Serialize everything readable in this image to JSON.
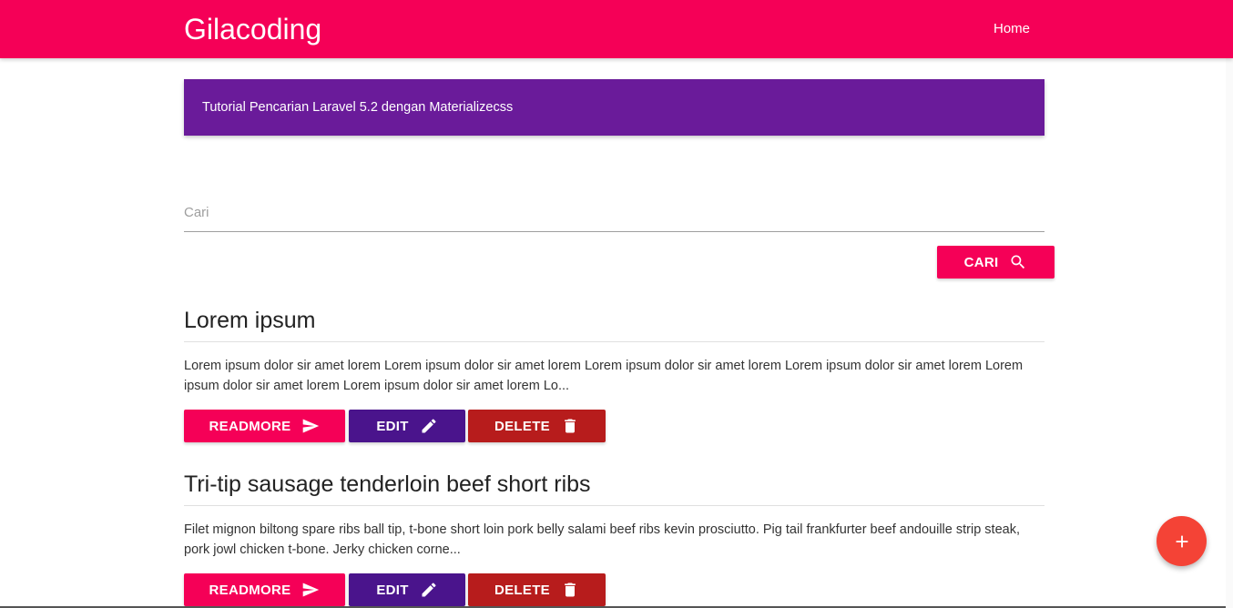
{
  "navbar": {
    "brand": "Gilacoding",
    "home_label": "Home"
  },
  "banner": {
    "text": "Tutorial Pencarian Laravel 5.2 dengan Materializecss"
  },
  "search": {
    "placeholder": "Cari",
    "value": "",
    "button_label": "CARI",
    "button_icon": "search-icon"
  },
  "posts": [
    {
      "title": "Lorem ipsum",
      "excerpt": "Lorem ipsum dolor sir amet lorem Lorem ipsum dolor sir amet lorem Lorem ipsum dolor sir amet lorem Lorem ipsum dolor sir amet lorem Lorem ipsum dolor sir amet lorem Lorem ipsum dolor sir amet lorem Lo...",
      "readmore_label": "READMORE",
      "edit_label": "EDIT",
      "delete_label": "DELETE"
    },
    {
      "title": "Tri-tip sausage tenderloin beef short ribs",
      "excerpt": "Filet mignon biltong spare ribs ball tip, t-bone short loin pork belly salami beef ribs kevin prosciutto. Pig tail frankfurter beef andouille strip steak, pork jowl chicken t-bone. Jerky chicken corne...",
      "readmore_label": "READMORE",
      "edit_label": "EDIT",
      "delete_label": "DELETE"
    }
  ],
  "fab": {
    "icon": "add-icon"
  },
  "colors": {
    "primary": "#f50057",
    "banner": "#6a1b9a",
    "edit": "#4a148c",
    "delete": "#b71c1c",
    "fab": "#f44336"
  }
}
